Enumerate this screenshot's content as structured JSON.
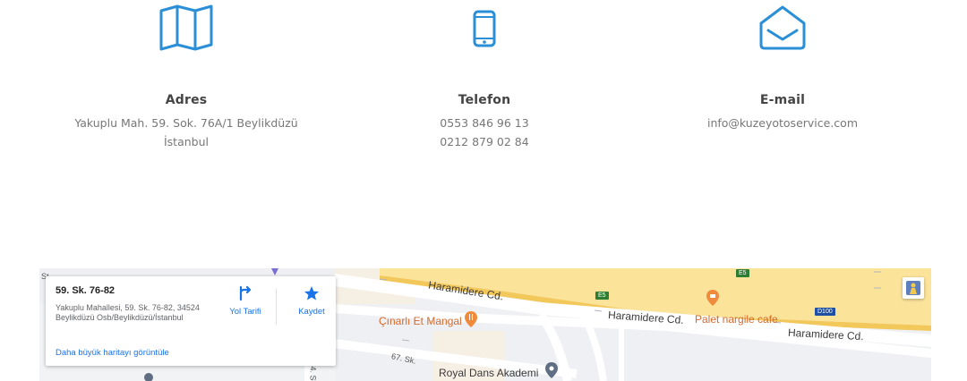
{
  "contacts": {
    "address": {
      "icon": "map-icon",
      "title": "Adres",
      "line1": "Yakuplu Mah. 59. Sok. 76A/1 Beylikdüzü",
      "line2": "İstanbul"
    },
    "phone": {
      "icon": "smartphone-icon",
      "title": "Telefon",
      "line1": "0553 846 96 13",
      "line2": "0212 879 02 84"
    },
    "email": {
      "icon": "envelope-icon",
      "title": "E-mail",
      "line1": "info@kuzeyotoservice.com"
    },
    "accent_color": "#2a8fd6"
  },
  "map": {
    "card": {
      "title": "59. Sk. 76-82",
      "address": "Yakuplu Mahallesi, 59. Sk. 76-82, 34524 Beylikdüzü Osb/Beylikdüzü/İstanbul",
      "directions_label": "Yol Tarifi",
      "save_label": "Kaydet",
      "larger_map_link": "Daha büyük haritayı görüntüle"
    },
    "labels": {
      "road_top": "Haramidere Cd.",
      "road_mid": "Haramidere Cd.",
      "road_right": "Haramidere Cd.",
      "poi_grill": "Çınarlı Et Mangal",
      "poi_cafe": "Palet nargile cafe",
      "poi_dance": "Royal Dans Akademi",
      "street_67": "67. Sk.",
      "street_side": "64. S",
      "street_corner": "St"
    },
    "badges": {
      "e5_top": "E5",
      "e5_mid": "E5",
      "d100": "D100"
    }
  }
}
